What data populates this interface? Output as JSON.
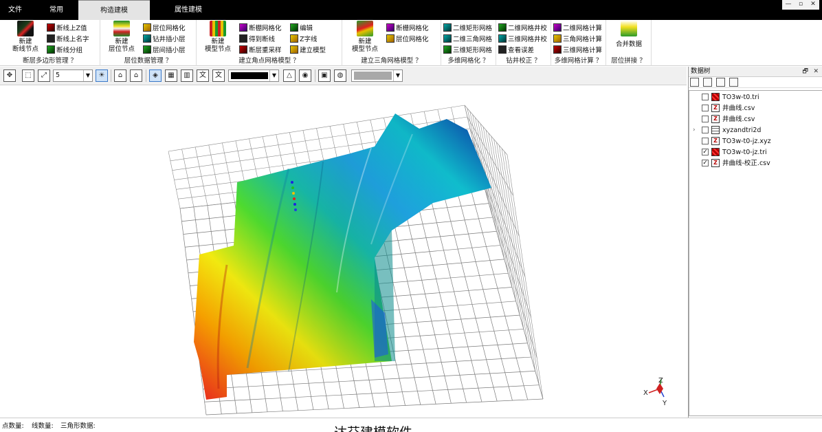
{
  "menu": {
    "items": [
      {
        "label": "文件",
        "active": false
      },
      {
        "label": "常用",
        "active": false
      },
      {
        "label": "构造建模",
        "active": true
      },
      {
        "label": "属性建模",
        "active": false
      }
    ]
  },
  "window_controls": {
    "minimize": "—",
    "restore": "▫",
    "close": "✕"
  },
  "ribbon": {
    "groups": [
      {
        "label": "断层多边形管理 ？",
        "big": {
          "label_line1": "新建",
          "label_line2": "断线节点",
          "icon": "fault-node-icon"
        },
        "small": [
          {
            "label": "断线上Z值",
            "icon": "fault-z-icon"
          },
          {
            "label": "断线上名字",
            "icon": "fault-name-icon"
          },
          {
            "label": "断线分组",
            "icon": "fault-group-icon"
          }
        ]
      },
      {
        "label": "层位数据管理 ？",
        "big": {
          "label_line1": "新建",
          "label_line2": "层位节点",
          "icon": "horizon-node-icon"
        },
        "small": [
          {
            "label": "层位网格化",
            "icon": "horizon-grid-icon"
          },
          {
            "label": "钻井插小层",
            "icon": "well-sublayer-icon"
          },
          {
            "label": "层间插小层",
            "icon": "interlayer-sublayer-icon"
          }
        ]
      },
      {
        "label": "建立角点网格模型 ？",
        "big": {
          "label_line1": "新建",
          "label_line2": "模型节点",
          "icon": "model-node-icon"
        },
        "small": [
          {
            "label": "断棚网格化",
            "icon": "fault-mesh-icon"
          },
          {
            "label": "得到断线",
            "icon": "get-fault-line-icon"
          },
          {
            "label": "断层重采样",
            "icon": "fault-resample-icon"
          },
          {
            "label": "编辑",
            "icon": "edit-icon"
          },
          {
            "label": "Z字线",
            "icon": "z-line-icon"
          },
          {
            "label": "建立模型",
            "icon": "build-model-icon"
          }
        ]
      },
      {
        "label": "建立三角网格模型 ？",
        "big": {
          "label_line1": "新建",
          "label_line2": "模型节点",
          "icon": "tri-model-node-icon"
        },
        "small": [
          {
            "label": "断栅网格化",
            "icon": "fault-fence-grid-icon"
          },
          {
            "label": "层位网格化",
            "icon": "horizon-grid-icon"
          }
        ]
      },
      {
        "label": "多维网格化 ？",
        "small": [
          {
            "label": "二维矩形网格",
            "icon": "rect-grid-2d-icon"
          },
          {
            "label": "二维三角网格",
            "icon": "tri-grid-2d-icon"
          },
          {
            "label": "三维矩形网格",
            "icon": "rect-grid-3d-icon"
          }
        ]
      },
      {
        "label": "钻井校正 ？",
        "small": [
          {
            "label": "二维网格井校",
            "icon": "well-correct-2d-icon"
          },
          {
            "label": "三维网格井校",
            "icon": "well-correct-3d-icon"
          },
          {
            "label": "查看误差",
            "icon": "view-error-icon"
          }
        ]
      },
      {
        "label": "多维网格计算 ？",
        "small": [
          {
            "label": "二维网格计算",
            "icon": "grid-calc-2d-icon"
          },
          {
            "label": "三角网格计算",
            "icon": "tri-grid-calc-icon"
          },
          {
            "label": "三维网格计算",
            "icon": "grid-calc-3d-icon"
          }
        ]
      },
      {
        "label": "层位拼接 ？",
        "big": {
          "label_line1": "合并数据",
          "label_line2": "",
          "icon": "merge-data-icon"
        }
      }
    ]
  },
  "toolbar": {
    "zoom_value": "5",
    "color_swatch": "#000000",
    "bg_swatch": "#a8a8a8"
  },
  "viewport": {
    "axes": {
      "x": "X",
      "y": "Y",
      "z": "Z"
    }
  },
  "panel": {
    "title": "数据树",
    "pin": "🗗",
    "close": "✕",
    "items": [
      {
        "name": "TO3w-t0.tri",
        "checked": false,
        "expandable": false,
        "type": "tri"
      },
      {
        "name": "井曲线.csv",
        "checked": false,
        "expandable": false,
        "type": "csv"
      },
      {
        "name": "井曲线.csv",
        "checked": false,
        "expandable": false,
        "type": "csv"
      },
      {
        "name": "xyzandtri2d",
        "checked": false,
        "expandable": true,
        "type": "grid"
      },
      {
        "name": "TO3w-t0-jz.xyz",
        "checked": false,
        "expandable": false,
        "type": "csv"
      },
      {
        "name": "TO3w-t0-jz.tri",
        "checked": true,
        "expandable": false,
        "type": "tri"
      },
      {
        "name": "井曲线-校正.csv",
        "checked": true,
        "expandable": false,
        "type": "csv"
      }
    ]
  },
  "status": {
    "points": "点数量:",
    "lines": "线数量:",
    "triangles": "三角形数据:"
  },
  "caption": "达芬建模软件"
}
